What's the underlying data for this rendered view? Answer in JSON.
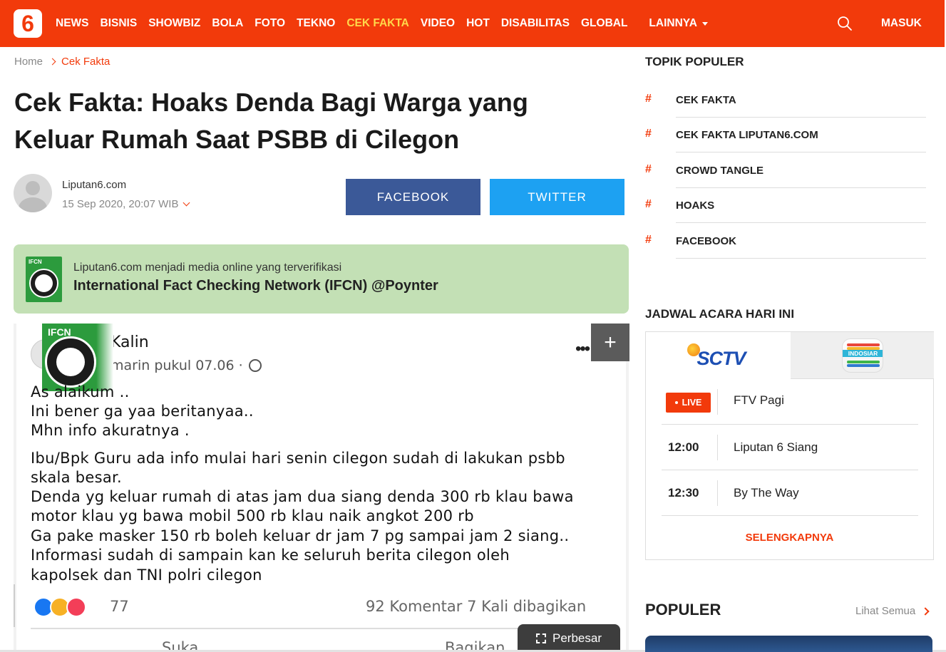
{
  "site": {
    "logo": "6",
    "nav": [
      "NEWS",
      "BISNIS",
      "SHOWBIZ",
      "BOLA",
      "FOTO",
      "TEKNO",
      "CEK FAKTA",
      "VIDEO",
      "HOT",
      "DISABILITAS",
      "GLOBAL"
    ],
    "nav_active_index": 6,
    "more_label": "LAINNYA",
    "login_label": "MASUK",
    "accent_color": "#f23a0b",
    "active_nav_color": "#ffd84a"
  },
  "breadcrumb": {
    "home": "Home",
    "current": "Cek Fakta"
  },
  "article": {
    "title_line1": "Cek Fakta: Hoaks Denda Bagi Warga yang",
    "title_line2": "Keluar Rumah Saat PSBB di Cilegon",
    "author": "Liputan6.com",
    "date": "15 Sep 2020, 20:07 WIB"
  },
  "share": {
    "facebook": "FACEBOOK",
    "twitter": "TWITTER",
    "facebook_color": "#3b5998",
    "twitter_color": "#1da1f2"
  },
  "ifcn": {
    "line1": "Liputan6.com menjadi media online yang terverifikasi",
    "line2": "International Fact Checking Network (IFCN) @Poynter",
    "badge_text": "IFCN",
    "background": "#c3e0b5"
  },
  "post": {
    "name": "Kalin",
    "time": "marin pukul 07.06 ·",
    "lines": [
      "As       alaikum ..",
      "Ini bener ga yaa beritanyaa..",
      "Mhn info akuratnya .",
      "Ibu/Bpk Guru ada info mulai hari senin cilegon sudah di lakukan psbb",
      "skala besar.",
      "Denda yg keluar rumah di atas jam dua siang denda 300 rb klau bawa",
      "motor klau yg bawa mobil 500 rb klau naik angkot 200 rb",
      "Ga pake masker 150 rb boleh keluar dr jam 7 pg sampai jam 2 siang..",
      "Informasi sudah di sampain kan ke seluruh berita cilegon oleh",
      "kapolsek dan TNI polri cilegon"
    ],
    "reaction_count": "77",
    "stats": "92 Komentar  7 Kali dibagikan",
    "like": "Suka",
    "share": "Bagikan",
    "enlarge_label": "Perbesar",
    "plus_label": "+"
  },
  "sidebar": {
    "topics_title": "TOPIK POPULER",
    "topics": [
      "CEK FAKTA",
      "CEK FAKTA LIPUTAN6.COM",
      "CROWD TANGLE",
      "HOAKS",
      "FACEBOOK"
    ],
    "schedule_title": "JADWAL ACARA HARI INI",
    "channels": [
      "SCTV",
      "INDOSIAR"
    ],
    "schedule": [
      {
        "time": "LIVE",
        "program": "FTV Pagi"
      },
      {
        "time": "12:00",
        "program": "Liputan 6 Siang"
      },
      {
        "time": "12:30",
        "program": "By The Way"
      }
    ],
    "more": "SELENGKAPNYA",
    "popular_title": "POPULER",
    "popular_all": "Lihat Semua"
  }
}
